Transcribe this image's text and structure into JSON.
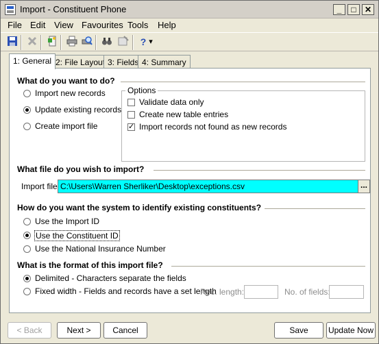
{
  "window": {
    "title": "Import - Constituent Phone"
  },
  "titlebar": {
    "minimize_label": "_",
    "maximize_label": "□",
    "close_label": "✕"
  },
  "menu": [
    "File",
    "Edit",
    "View",
    "Favourites",
    "Tools",
    "Help"
  ],
  "toolbar": {
    "icons": [
      "save-icon",
      "delete-icon",
      "properties-icon",
      "print-icon",
      "print-preview-icon",
      "find-icon",
      "view-icon",
      "help-icon",
      "dropdown-arrow-icon"
    ],
    "help_glyph": "?",
    "dropdown_glyph": "▾"
  },
  "tabs": [
    {
      "label": "1: General",
      "active": true
    },
    {
      "label": "2: File Layout",
      "active": false
    },
    {
      "label": "3: Fields",
      "active": false
    },
    {
      "label": "4: Summary",
      "active": false
    }
  ],
  "general": {
    "todo": {
      "heading": "What do you want to do?",
      "options": [
        "Import new records",
        "Update existing records",
        "Create import file"
      ],
      "selected": "Update existing records"
    },
    "options_box": {
      "legend": "Options",
      "items": [
        {
          "label": "Validate data only",
          "checked": false
        },
        {
          "label": "Create new table entries",
          "checked": false
        },
        {
          "label": "Import records not found as new records",
          "checked": true
        }
      ]
    },
    "file": {
      "heading": "What file do you wish to import?",
      "label": "Import file:",
      "value": "C:\\Users\\Warren Sherliker\\Desktop\\exceptions.csv",
      "browse_label": "..."
    },
    "identify": {
      "heading": "How do you want the system to identify existing constituents?",
      "options": [
        "Use the Import ID",
        "Use the Constituent ID",
        "Use the National Insurance Number"
      ],
      "selected": "Use the Constituent ID"
    },
    "format": {
      "heading": "What is the format of this import file?",
      "options": [
        "Delimited - Characters separate the fields",
        "Fixed width - Fields and records have a set length"
      ],
      "selected": "Delimited - Characters separate the fields",
      "rec_length_label": "Rec. length:",
      "rec_length_value": "",
      "num_fields_label": "No. of fields:",
      "num_fields_value": ""
    }
  },
  "buttons": {
    "back": "< Back",
    "next": "Next >",
    "cancel": "Cancel",
    "save": "Save",
    "update_now": "Update Now"
  },
  "colors": {
    "file_field_bg": "#00ffff",
    "window_bg": "#ece9d8"
  }
}
